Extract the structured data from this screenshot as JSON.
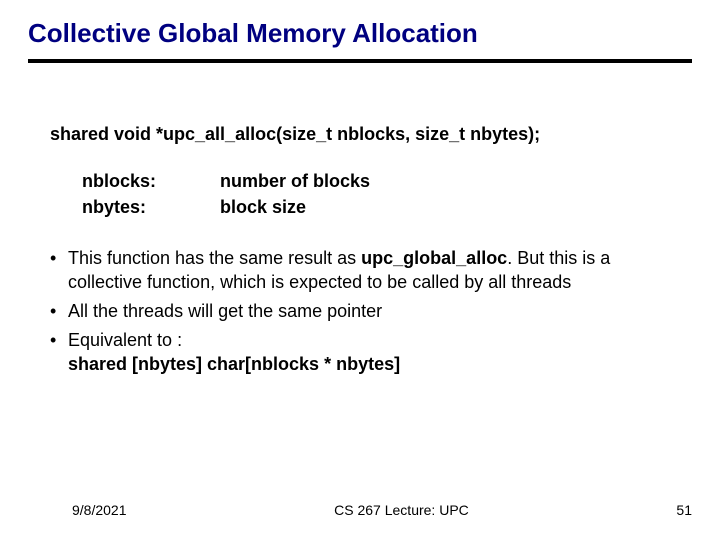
{
  "title": "Collective Global Memory Allocation",
  "signature": "shared void *upc_all_alloc(size_t nblocks, size_t nbytes);",
  "params": {
    "p1_name": "nblocks:",
    "p1_desc": "number of blocks",
    "p2_name": "nbytes:",
    "p2_desc": "block size"
  },
  "bullets": {
    "b1_pre": "This function has the same result as ",
    "b1_bold": "upc_global_alloc",
    "b1_post": ". But this is a collective function, which is expected to be called by all threads",
    "b2": "All the threads will get the same pointer",
    "b3_pre": "Equivalent to :",
    "b3_bold": "shared [nbytes] char[nblocks * nbytes]"
  },
  "footer": {
    "date": "9/8/2021",
    "center": "CS 267 Lecture: UPC",
    "page": "51"
  }
}
